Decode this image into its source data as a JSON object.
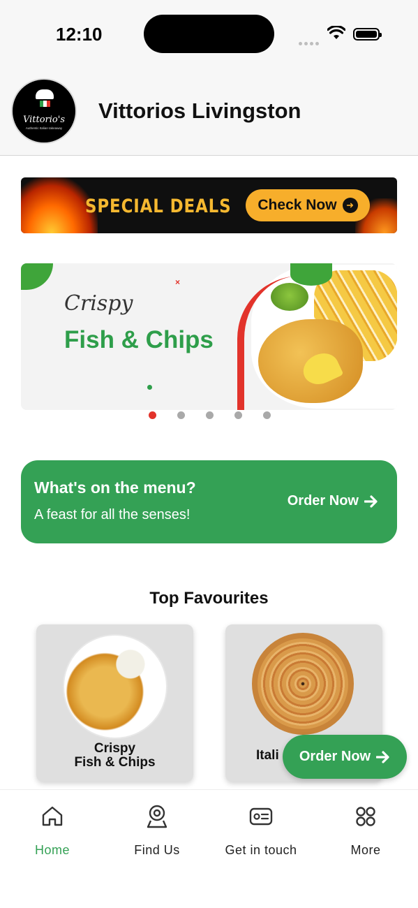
{
  "status_bar": {
    "time": "12:10"
  },
  "header": {
    "title": "Vittorios Livingston",
    "logo_name": "Vittorio's",
    "logo_tagline": "Authentic Italian takeaway"
  },
  "promo": {
    "label": "SPECIAL DEALS",
    "button": "Check Now"
  },
  "carousel": {
    "script_text": "Crispy",
    "title": "Fish & Chips",
    "slide_count": 5,
    "active_index": 0
  },
  "menu_card": {
    "title": "What's on the menu?",
    "subtitle": "A feast for all the senses!",
    "action": "Order Now"
  },
  "favourites": {
    "heading": "Top Favourites",
    "items": [
      {
        "line1": "Crispy",
        "line2": "Fish & Chips"
      },
      {
        "line1": "Itali",
        "line2": ""
      }
    ]
  },
  "floating_button": {
    "label": "Order Now"
  },
  "bottom_nav": {
    "items": [
      {
        "label": "Home",
        "icon": "home-icon",
        "active": true
      },
      {
        "label": "Find Us",
        "icon": "location-icon",
        "active": false
      },
      {
        "label": "Get in touch",
        "icon": "contact-card-icon",
        "active": false
      },
      {
        "label": "More",
        "icon": "grid-icon",
        "active": false
      }
    ]
  },
  "colors": {
    "brand_green": "#34a155",
    "accent_red": "#e2332b",
    "deal_orange": "#f7ae2b"
  }
}
